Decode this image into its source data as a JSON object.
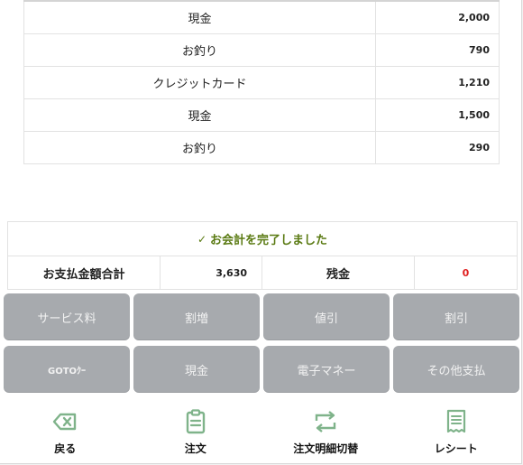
{
  "payments": [
    {
      "method": "現金",
      "amount": "2,000"
    },
    {
      "method": "お釣り",
      "amount": "790"
    },
    {
      "method": "クレジットカード",
      "amount": "1,210"
    },
    {
      "method": "現金",
      "amount": "1,500"
    },
    {
      "method": "お釣り",
      "amount": "290"
    }
  ],
  "summary": {
    "status": "お会計を完了しました",
    "total_label": "お支払金額合計",
    "total_value": "3,630",
    "remaining_label": "残金",
    "remaining_value": "0"
  },
  "keypad": [
    "サービス料",
    "割増",
    "値引",
    "割引",
    "GOTOｸｰ",
    "現金",
    "電子マネー",
    "その他支払"
  ],
  "nav": {
    "back": "戻る",
    "order": "注文",
    "switch_details": "注文明細切替",
    "receipt": "レシート"
  },
  "colors": {
    "accent": "#5a7a12",
    "alert": "#e02020",
    "key_bg": "#a7aaae",
    "icon": "#7fb38a"
  },
  "icons": {
    "back": "backspace-icon",
    "order": "clipboard-icon",
    "switch": "repeat-icon",
    "receipt": "receipt-icon"
  }
}
